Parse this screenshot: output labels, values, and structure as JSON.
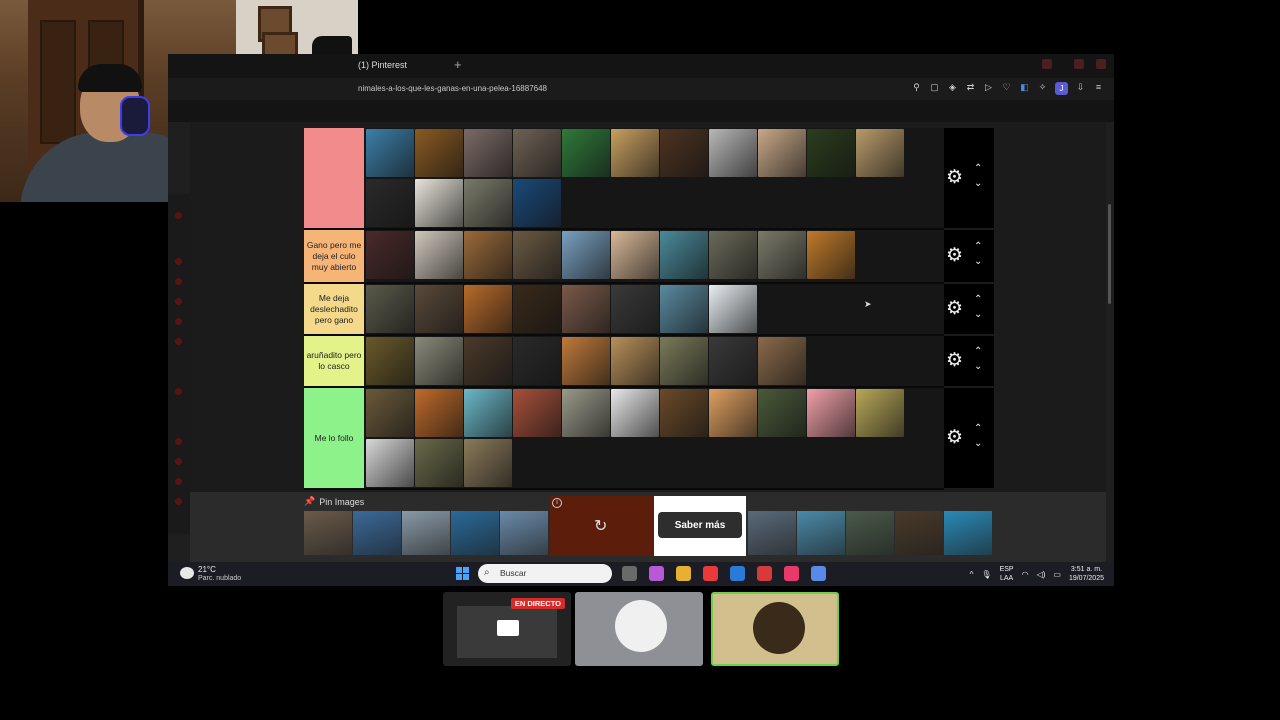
{
  "browser": {
    "tab_title": "(1) Pinterest",
    "url": "nimales-a-los-que-les-ganas-en-una-pelea-16887648",
    "profile_initial": "J",
    "toolbar_icons": [
      "pin-icon",
      "crop-icon",
      "shield-icon",
      "translate-icon",
      "play-icon",
      "heart-icon",
      "extension-icon",
      "puzzle-icon",
      "download-icon",
      "menu-icon"
    ]
  },
  "tier_list": {
    "rows": [
      {
        "label": "",
        "color": "#f28b8b",
        "height": 100,
        "tiles": [
          "#3d7fa8",
          "#8a5a22",
          "#7a6a66",
          "#6e6254",
          "#2f7a3a",
          "#c8a060",
          "#4d3322",
          "#b8b8b8",
          "#c8a888",
          "#2b3d1e",
          "#b89a6a",
          "#2a2a2a",
          "#e8e4da",
          "#7a7a6a",
          "#1b4a7a"
        ]
      },
      {
        "label": "Gano pero me deja el culo muy abierto",
        "color": "#f6b577",
        "height": 52,
        "tiles": [
          "#4a2a2a",
          "#d0c8bc",
          "#9a6a3a",
          "#6a5a44",
          "#7aa0c0",
          "#d8b898",
          "#4a8a9a",
          "#6a6a5a",
          "#7a7a6a",
          "#c07a2a"
        ]
      },
      {
        "label": "Me deja deslechadito pero gano",
        "color": "#f4d98a",
        "height": 50,
        "tiles": [
          "#5a5a4a",
          "#5a4a3a",
          "#b86a2a",
          "#3a2a1a",
          "#7a5a4a",
          "#3a3a3a",
          "#5a8aa0",
          "#e8eef2"
        ]
      },
      {
        "label": "aruñadito pero lo casco",
        "color": "#e4f28a",
        "height": 50,
        "tiles": [
          "#6a5a2a",
          "#8a8a7a",
          "#4a3a2a",
          "#2a2a2a",
          "#c07a3a",
          "#b8905a",
          "#7a7a5a",
          "#3a3a3a",
          "#8a6a4a"
        ]
      },
      {
        "label": "Me lo follo",
        "color": "#8ef28a",
        "height": 100,
        "tiles": [
          "#6a5a3a",
          "#c06a2a",
          "#6ab8c8",
          "#a8503a",
          "#9a9a8a",
          "#e8e8e8",
          "#6a4a2a",
          "#e0a060",
          "#4a5a3a",
          "#f0a0a8",
          "#b8a858",
          "#d8d8d8",
          "#6a6a4a",
          "#8a7a5a"
        ]
      }
    ]
  },
  "pin_section": {
    "title": "Pin Images",
    "tiles_left": [
      "#6a5a4a",
      "#3a6a9a",
      "#8a9aa8",
      "#2a6a9a",
      "#6a8aa8"
    ],
    "tiles_right": [
      "#5a6a7a",
      "#4a8aa8",
      "#4a5a4a",
      "#4a3a2a",
      "#2a8ab8"
    ],
    "ad_button": "Saber más"
  },
  "taskbar": {
    "temp": "21°C",
    "weather": "Parc. nublado",
    "search_placeholder": "Buscar",
    "lang_top": "ESP",
    "lang_bottom": "LAA",
    "time": "3:51 a. m.",
    "date": "19/07/2025",
    "apps": [
      "#6a6a6a",
      "#b85ad8",
      "#e8b030",
      "#e83a3a",
      "#2a7ad8",
      "#d83a3a",
      "#e83a6a",
      "#5a8ae8"
    ]
  },
  "participants": {
    "live_badge": "EN DIRECTO"
  }
}
